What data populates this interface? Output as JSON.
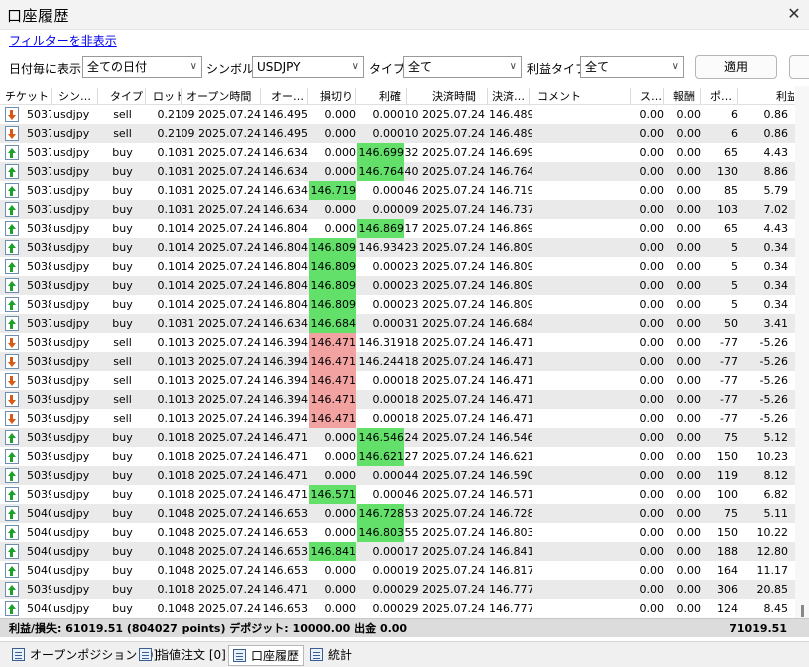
{
  "window": {
    "title": "口座履歴",
    "close_glyph": "✕"
  },
  "filter_link": "フィルターを非表示",
  "filters": {
    "date_label": "日付毎に表示",
    "date_value": "全ての日付",
    "symbol_label": "シンボル:",
    "symbol_value": "USDJPY",
    "type_label": "タイプ:",
    "type_value": "全て",
    "profit_type_label": "利益タイプ",
    "profit_type_value": "全て",
    "apply_label": "適用"
  },
  "columns": [
    "チケット",
    "シン…",
    "タイプ",
    "ロット",
    "オープン時間",
    "オー…",
    "損切り",
    "利確",
    "決済時間",
    "決済…",
    "コメント",
    "ス…",
    "報酬",
    "ポ…",
    "利益"
  ],
  "rows": [
    {
      "icon": "sell",
      "ticket": "5037",
      "symbol": "usdjpy",
      "type": "sell",
      "lot": "0.21",
      "open_time": "2025.07.24 15:09",
      "open_price": "146.495",
      "sl": "0.000",
      "sl_hl": "",
      "tp": "0.000",
      "tp_hl": "",
      "close_time": "2025.07.24 15:10",
      "close_price": "146.489",
      "comment": "",
      "swap": "0.00",
      "fee": "0.00",
      "points": "6",
      "profit": "0.86"
    },
    {
      "icon": "sell",
      "ticket": "5037",
      "symbol": "usdjpy",
      "type": "sell",
      "lot": "0.21",
      "open_time": "2025.07.24 15:09",
      "open_price": "146.495",
      "sl": "0.000",
      "sl_hl": "",
      "tp": "0.000",
      "tp_hl": "",
      "close_time": "2025.07.24 15:10",
      "close_price": "146.489",
      "comment": "",
      "swap": "0.00",
      "fee": "0.00",
      "points": "6",
      "profit": "0.86"
    },
    {
      "icon": "buy",
      "ticket": "5037",
      "symbol": "usdjpy",
      "type": "buy",
      "lot": "0.10",
      "open_time": "2025.07.24 15:31",
      "open_price": "146.634",
      "sl": "0.000",
      "sl_hl": "",
      "tp": "146.699",
      "tp_hl": "green",
      "close_time": "2025.07.24 15:32",
      "close_price": "146.699",
      "comment": "",
      "swap": "0.00",
      "fee": "0.00",
      "points": "65",
      "profit": "4.43"
    },
    {
      "icon": "buy",
      "ticket": "5037",
      "symbol": "usdjpy",
      "type": "buy",
      "lot": "0.10",
      "open_time": "2025.07.24 15:31",
      "open_price": "146.634",
      "sl": "0.000",
      "sl_hl": "",
      "tp": "146.764",
      "tp_hl": "green",
      "close_time": "2025.07.24 15:40",
      "close_price": "146.764",
      "comment": "",
      "swap": "0.00",
      "fee": "0.00",
      "points": "130",
      "profit": "8.86"
    },
    {
      "icon": "buy",
      "ticket": "5037",
      "symbol": "usdjpy",
      "type": "buy",
      "lot": "0.10",
      "open_time": "2025.07.24 15:31",
      "open_price": "146.634",
      "sl": "146.719",
      "sl_hl": "green",
      "tp": "0.000",
      "tp_hl": "",
      "close_time": "2025.07.24 15:46",
      "close_price": "146.719",
      "comment": "",
      "swap": "0.00",
      "fee": "0.00",
      "points": "85",
      "profit": "5.79"
    },
    {
      "icon": "buy",
      "ticket": "5037",
      "symbol": "usdjpy",
      "type": "buy",
      "lot": "0.10",
      "open_time": "2025.07.24 15:31",
      "open_price": "146.634",
      "sl": "0.000",
      "sl_hl": "",
      "tp": "0.000",
      "tp_hl": "",
      "close_time": "2025.07.24 16:09",
      "close_price": "146.737",
      "comment": "",
      "swap": "0.00",
      "fee": "0.00",
      "points": "103",
      "profit": "7.02"
    },
    {
      "icon": "buy",
      "ticket": "5038",
      "symbol": "usdjpy",
      "type": "buy",
      "lot": "0.10",
      "open_time": "2025.07.24 16:14",
      "open_price": "146.804",
      "sl": "0.000",
      "sl_hl": "",
      "tp": "146.869",
      "tp_hl": "green",
      "close_time": "2025.07.24 16:17",
      "close_price": "146.869",
      "comment": "",
      "swap": "0.00",
      "fee": "0.00",
      "points": "65",
      "profit": "4.43"
    },
    {
      "icon": "buy",
      "ticket": "5038",
      "symbol": "usdjpy",
      "type": "buy",
      "lot": "0.10",
      "open_time": "2025.07.24 16:14",
      "open_price": "146.804",
      "sl": "146.809",
      "sl_hl": "green",
      "tp": "146.934",
      "tp_hl": "",
      "close_time": "2025.07.24 16:23",
      "close_price": "146.809",
      "comment": "",
      "swap": "0.00",
      "fee": "0.00",
      "points": "5",
      "profit": "0.34"
    },
    {
      "icon": "buy",
      "ticket": "5038",
      "symbol": "usdjpy",
      "type": "buy",
      "lot": "0.10",
      "open_time": "2025.07.24 16:14",
      "open_price": "146.804",
      "sl": "146.809",
      "sl_hl": "green",
      "tp": "0.000",
      "tp_hl": "",
      "close_time": "2025.07.24 16:23",
      "close_price": "146.809",
      "comment": "",
      "swap": "0.00",
      "fee": "0.00",
      "points": "5",
      "profit": "0.34"
    },
    {
      "icon": "buy",
      "ticket": "5038",
      "symbol": "usdjpy",
      "type": "buy",
      "lot": "0.10",
      "open_time": "2025.07.24 16:14",
      "open_price": "146.804",
      "sl": "146.809",
      "sl_hl": "green",
      "tp": "0.000",
      "tp_hl": "",
      "close_time": "2025.07.24 16:23",
      "close_price": "146.809",
      "comment": "",
      "swap": "0.00",
      "fee": "0.00",
      "points": "5",
      "profit": "0.34"
    },
    {
      "icon": "buy",
      "ticket": "5038",
      "symbol": "usdjpy",
      "type": "buy",
      "lot": "0.10",
      "open_time": "2025.07.24 16:14",
      "open_price": "146.804",
      "sl": "146.809",
      "sl_hl": "green",
      "tp": "0.000",
      "tp_hl": "",
      "close_time": "2025.07.24 16:23",
      "close_price": "146.809",
      "comment": "",
      "swap": "0.00",
      "fee": "0.00",
      "points": "5",
      "profit": "0.34"
    },
    {
      "icon": "buy",
      "ticket": "5037",
      "symbol": "usdjpy",
      "type": "buy",
      "lot": "0.10",
      "open_time": "2025.07.24 15:31",
      "open_price": "146.634",
      "sl": "146.684",
      "sl_hl": "green",
      "tp": "0.000",
      "tp_hl": "",
      "close_time": "2025.07.24 16:31",
      "close_price": "146.684",
      "comment": "",
      "swap": "0.00",
      "fee": "0.00",
      "points": "50",
      "profit": "3.41"
    },
    {
      "icon": "sell",
      "ticket": "5038",
      "symbol": "usdjpy",
      "type": "sell",
      "lot": "0.10",
      "open_time": "2025.07.24 17:13",
      "open_price": "146.394",
      "sl": "146.471",
      "sl_hl": "red",
      "tp": "146.319",
      "tp_hl": "",
      "close_time": "2025.07.24 17:18",
      "close_price": "146.471",
      "comment": "",
      "swap": "0.00",
      "fee": "0.00",
      "points": "-77",
      "profit": "-5.26"
    },
    {
      "icon": "sell",
      "ticket": "5038",
      "symbol": "usdjpy",
      "type": "sell",
      "lot": "0.10",
      "open_time": "2025.07.24 17:13",
      "open_price": "146.394",
      "sl": "146.471",
      "sl_hl": "red",
      "tp": "146.244",
      "tp_hl": "",
      "close_time": "2025.07.24 17:18",
      "close_price": "146.471",
      "comment": "",
      "swap": "0.00",
      "fee": "0.00",
      "points": "-77",
      "profit": "-5.26"
    },
    {
      "icon": "sell",
      "ticket": "5038",
      "symbol": "usdjpy",
      "type": "sell",
      "lot": "0.10",
      "open_time": "2025.07.24 17:13",
      "open_price": "146.394",
      "sl": "146.471",
      "sl_hl": "red",
      "tp": "0.000",
      "tp_hl": "",
      "close_time": "2025.07.24 17:18",
      "close_price": "146.471",
      "comment": "",
      "swap": "0.00",
      "fee": "0.00",
      "points": "-77",
      "profit": "-5.26"
    },
    {
      "icon": "sell",
      "ticket": "5039",
      "symbol": "usdjpy",
      "type": "sell",
      "lot": "0.10",
      "open_time": "2025.07.24 17:13",
      "open_price": "146.394",
      "sl": "146.471",
      "sl_hl": "red",
      "tp": "0.000",
      "tp_hl": "",
      "close_time": "2025.07.24 17:18",
      "close_price": "146.471",
      "comment": "",
      "swap": "0.00",
      "fee": "0.00",
      "points": "-77",
      "profit": "-5.26"
    },
    {
      "icon": "sell",
      "ticket": "5039",
      "symbol": "usdjpy",
      "type": "sell",
      "lot": "0.10",
      "open_time": "2025.07.24 17:13",
      "open_price": "146.394",
      "sl": "146.471",
      "sl_hl": "red",
      "tp": "0.000",
      "tp_hl": "",
      "close_time": "2025.07.24 17:18",
      "close_price": "146.471",
      "comment": "",
      "swap": "0.00",
      "fee": "0.00",
      "points": "-77",
      "profit": "-5.26"
    },
    {
      "icon": "buy",
      "ticket": "5039",
      "symbol": "usdjpy",
      "type": "buy",
      "lot": "0.10",
      "open_time": "2025.07.24 17:18",
      "open_price": "146.471",
      "sl": "0.000",
      "sl_hl": "",
      "tp": "146.546",
      "tp_hl": "green",
      "close_time": "2025.07.24 17:24",
      "close_price": "146.546",
      "comment": "",
      "swap": "0.00",
      "fee": "0.00",
      "points": "75",
      "profit": "5.12"
    },
    {
      "icon": "buy",
      "ticket": "5039",
      "symbol": "usdjpy",
      "type": "buy",
      "lot": "0.10",
      "open_time": "2025.07.24 17:18",
      "open_price": "146.471",
      "sl": "0.000",
      "sl_hl": "",
      "tp": "146.621",
      "tp_hl": "green",
      "close_time": "2025.07.24 17:27",
      "close_price": "146.621",
      "comment": "",
      "swap": "0.00",
      "fee": "0.00",
      "points": "150",
      "profit": "10.23"
    },
    {
      "icon": "buy",
      "ticket": "5039",
      "symbol": "usdjpy",
      "type": "buy",
      "lot": "0.10",
      "open_time": "2025.07.24 17:18",
      "open_price": "146.471",
      "sl": "0.000",
      "sl_hl": "",
      "tp": "0.000",
      "tp_hl": "",
      "close_time": "2025.07.24 17:44",
      "close_price": "146.590",
      "comment": "",
      "swap": "0.00",
      "fee": "0.00",
      "points": "119",
      "profit": "8.12"
    },
    {
      "icon": "buy",
      "ticket": "5039",
      "symbol": "usdjpy",
      "type": "buy",
      "lot": "0.10",
      "open_time": "2025.07.24 17:18",
      "open_price": "146.471",
      "sl": "146.571",
      "sl_hl": "green",
      "tp": "0.000",
      "tp_hl": "",
      "close_time": "2025.07.24 17:46",
      "close_price": "146.571",
      "comment": "",
      "swap": "0.00",
      "fee": "0.00",
      "points": "100",
      "profit": "6.82"
    },
    {
      "icon": "buy",
      "ticket": "5040",
      "symbol": "usdjpy",
      "type": "buy",
      "lot": "0.10",
      "open_time": "2025.07.24 17:48",
      "open_price": "146.653",
      "sl": "0.000",
      "sl_hl": "",
      "tp": "146.728",
      "tp_hl": "green",
      "close_time": "2025.07.24 17:53",
      "close_price": "146.728",
      "comment": "",
      "swap": "0.00",
      "fee": "0.00",
      "points": "75",
      "profit": "5.11"
    },
    {
      "icon": "buy",
      "ticket": "5040",
      "symbol": "usdjpy",
      "type": "buy",
      "lot": "0.10",
      "open_time": "2025.07.24 17:48",
      "open_price": "146.653",
      "sl": "0.000",
      "sl_hl": "",
      "tp": "146.803",
      "tp_hl": "green",
      "close_time": "2025.07.24 17:55",
      "close_price": "146.803",
      "comment": "",
      "swap": "0.00",
      "fee": "0.00",
      "points": "150",
      "profit": "10.22"
    },
    {
      "icon": "buy",
      "ticket": "5040",
      "symbol": "usdjpy",
      "type": "buy",
      "lot": "0.10",
      "open_time": "2025.07.24 17:48",
      "open_price": "146.653",
      "sl": "146.841",
      "sl_hl": "green",
      "tp": "0.000",
      "tp_hl": "",
      "close_time": "2025.07.24 18:17",
      "close_price": "146.841",
      "comment": "",
      "swap": "0.00",
      "fee": "0.00",
      "points": "188",
      "profit": "12.80"
    },
    {
      "icon": "buy",
      "ticket": "5040",
      "symbol": "usdjpy",
      "type": "buy",
      "lot": "0.10",
      "open_time": "2025.07.24 17:48",
      "open_price": "146.653",
      "sl": "0.000",
      "sl_hl": "",
      "tp": "0.000",
      "tp_hl": "",
      "close_time": "2025.07.24 18:19",
      "close_price": "146.817",
      "comment": "",
      "swap": "0.00",
      "fee": "0.00",
      "points": "164",
      "profit": "11.17"
    },
    {
      "icon": "buy",
      "ticket": "5039",
      "symbol": "usdjpy",
      "type": "buy",
      "lot": "0.10",
      "open_time": "2025.07.24 17:18",
      "open_price": "146.471",
      "sl": "0.000",
      "sl_hl": "",
      "tp": "0.000",
      "tp_hl": "",
      "close_time": "2025.07.24 20:29",
      "close_price": "146.777",
      "comment": "",
      "swap": "0.00",
      "fee": "0.00",
      "points": "306",
      "profit": "20.85"
    },
    {
      "icon": "buy",
      "ticket": "5040",
      "symbol": "usdjpy",
      "type": "buy",
      "lot": "0.10",
      "open_time": "2025.07.24 17:48",
      "open_price": "146.653",
      "sl": "0.000",
      "sl_hl": "",
      "tp": "0.000",
      "tp_hl": "",
      "close_time": "2025.07.24 20:29",
      "close_price": "146.777",
      "comment": "",
      "swap": "0.00",
      "fee": "0.00",
      "points": "124",
      "profit": "8.45"
    }
  ],
  "summary": {
    "left": "利益/損失: 61019.51 (804027 points) デポジット: 10000.00 出金 0.00",
    "right": "71019.51"
  },
  "tabs": [
    {
      "label": "オープンポジション [0]",
      "icon": "positions-icon"
    },
    {
      "label": "指値注文 [0]",
      "icon": "orders-icon"
    },
    {
      "label": "口座履歴",
      "icon": "history-icon"
    },
    {
      "label": "統計",
      "icon": "stats-icon"
    }
  ],
  "colors": {
    "tp_sl_hit_green": "#62e06a",
    "sl_loss_red": "#f3a2a2",
    "alt_row": "#eaeaea"
  }
}
